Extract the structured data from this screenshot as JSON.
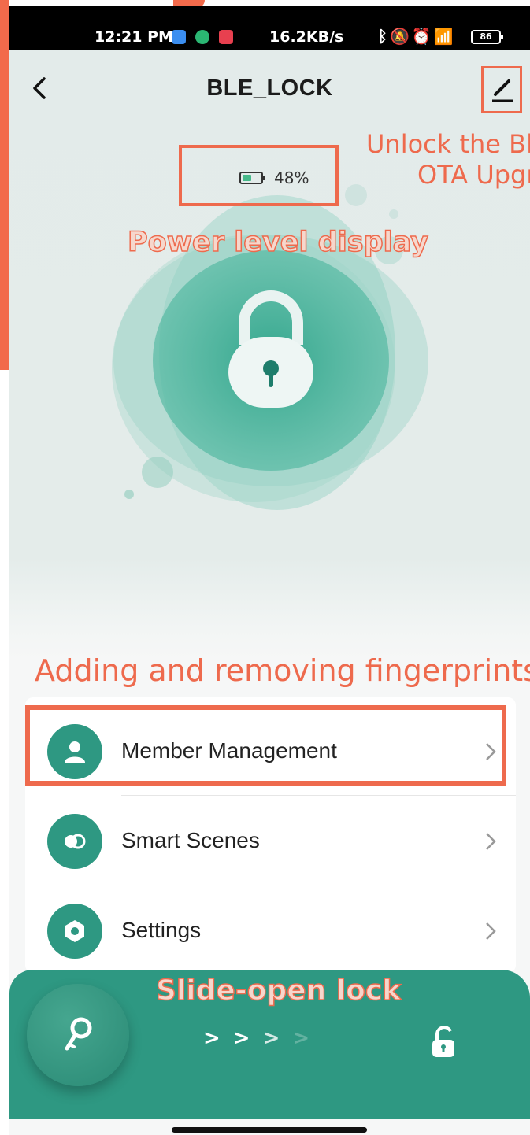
{
  "status_bar": {
    "time": "12:21 PM",
    "network_speed": "16.2KB/s",
    "battery": "86"
  },
  "header": {
    "title": "BLE_LOCK"
  },
  "lock": {
    "battery_level": 0.48,
    "battery_text": "48%"
  },
  "annotations": {
    "ota_line1": "Unlock the Bl",
    "ota_line2": "OTA Upgr",
    "power": "Power level display",
    "adding": "Adding and removing fingerprints",
    "slide": "Slide-open lock"
  },
  "menu": {
    "items": [
      {
        "label": "Member Management",
        "icon": "person-icon"
      },
      {
        "label": "Smart Scenes",
        "icon": "scenes-toggle-icon"
      },
      {
        "label": "Settings",
        "icon": "gear-icon"
      }
    ]
  },
  "slider": {
    "arrows": [
      ">",
      ">",
      ">",
      ">"
    ]
  },
  "colors": {
    "accent": "#2e9882",
    "annotation": "#ee6a4d",
    "battery_fill": "#46b98a"
  }
}
